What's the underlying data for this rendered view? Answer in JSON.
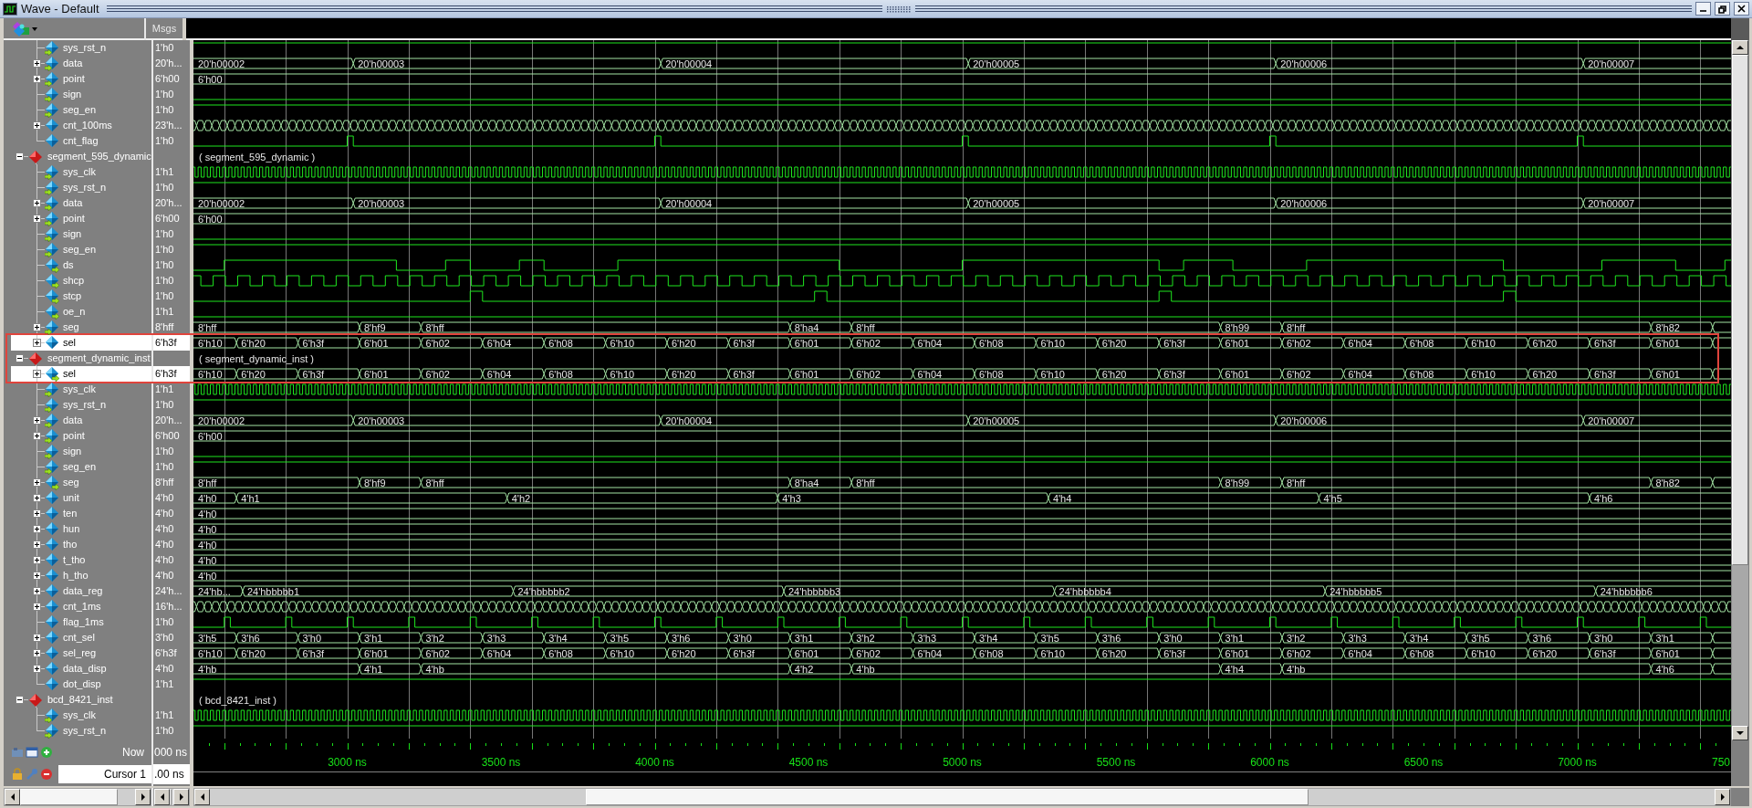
{
  "window": {
    "title": "Wave - Default"
  },
  "header": {
    "value_column": "Msgs"
  },
  "signals": [
    {
      "name": "sys_rst_n",
      "value": "1'h0",
      "kind": "bit",
      "input": true,
      "output": false,
      "expandable": false,
      "expanded": false,
      "selected": false,
      "highlighted": false
    },
    {
      "name": "data",
      "value": "20'h...",
      "kind": "bus",
      "input": true,
      "output": false,
      "expandable": true,
      "expanded": false,
      "selected": false,
      "highlighted": false,
      "values": [
        "20'h00002",
        "20'h00003",
        "20'h00004",
        "20'h00005",
        "20'h00006",
        "20'h00007"
      ]
    },
    {
      "name": "point",
      "value": "6'h00",
      "kind": "bus",
      "input": true,
      "output": false,
      "expandable": true,
      "expanded": false,
      "selected": false,
      "highlighted": false,
      "values": [
        "6'h00"
      ]
    },
    {
      "name": "sign",
      "value": "1'h0",
      "kind": "bit",
      "input": true,
      "output": false,
      "expandable": false,
      "expanded": false,
      "selected": false,
      "highlighted": false
    },
    {
      "name": "seg_en",
      "value": "1'h0",
      "kind": "bit",
      "input": true,
      "output": false,
      "expandable": false,
      "expanded": false,
      "selected": false,
      "highlighted": false
    },
    {
      "name": "cnt_100ms",
      "value": "23'h...",
      "kind": "bus",
      "input": false,
      "output": false,
      "expandable": true,
      "expanded": false,
      "selected": false,
      "highlighted": false
    },
    {
      "name": "cnt_flag",
      "value": "1'h0",
      "kind": "bit",
      "input": false,
      "output": false,
      "expandable": false,
      "expanded": false,
      "selected": false,
      "highlighted": false
    },
    {
      "name": "segment_595_dynamic",
      "kind": "group",
      "expandable": true,
      "expanded": true,
      "selected": false,
      "highlighted": false,
      "values": [
        "( segment_595_dynamic )"
      ]
    },
    {
      "name": "sys_clk",
      "value": "1'h1",
      "kind": "bit",
      "input": true,
      "output": false,
      "expandable": false,
      "expanded": false,
      "selected": false,
      "highlighted": false
    },
    {
      "name": "sys_rst_n",
      "value": "1'h0",
      "kind": "bit",
      "input": true,
      "output": false,
      "expandable": false,
      "expanded": false,
      "selected": false,
      "highlighted": false
    },
    {
      "name": "data",
      "value": "20'h...",
      "kind": "bus",
      "input": true,
      "output": false,
      "expandable": true,
      "expanded": false,
      "selected": false,
      "highlighted": false,
      "values": [
        "20'h00002",
        "20'h00003",
        "20'h00004",
        "20'h00005",
        "20'h00006",
        "20'h00007"
      ]
    },
    {
      "name": "point",
      "value": "6'h00",
      "kind": "bus",
      "input": true,
      "output": false,
      "expandable": true,
      "expanded": false,
      "selected": false,
      "highlighted": false,
      "values": [
        "6'h00"
      ]
    },
    {
      "name": "sign",
      "value": "1'h0",
      "kind": "bit",
      "input": true,
      "output": false,
      "expandable": false,
      "expanded": false,
      "selected": false,
      "highlighted": false
    },
    {
      "name": "seg_en",
      "value": "1'h0",
      "kind": "bit",
      "input": true,
      "output": false,
      "expandable": false,
      "expanded": false,
      "selected": false,
      "highlighted": false
    },
    {
      "name": "ds",
      "value": "1'h0",
      "kind": "bit",
      "input": false,
      "output": true,
      "expandable": false,
      "expanded": false,
      "selected": false,
      "highlighted": false
    },
    {
      "name": "shcp",
      "value": "1'h0",
      "kind": "bit",
      "input": false,
      "output": true,
      "expandable": false,
      "expanded": false,
      "selected": false,
      "highlighted": false
    },
    {
      "name": "stcp",
      "value": "1'h0",
      "kind": "bit",
      "input": false,
      "output": true,
      "expandable": false,
      "expanded": false,
      "selected": false,
      "highlighted": false
    },
    {
      "name": "oe_n",
      "value": "1'h1",
      "kind": "bit",
      "input": false,
      "output": true,
      "expandable": false,
      "expanded": false,
      "selected": false,
      "highlighted": false
    },
    {
      "name": "seg",
      "value": "8'hff",
      "kind": "bus",
      "input": true,
      "output": false,
      "expandable": true,
      "expanded": false,
      "selected": false,
      "highlighted": false,
      "values": [
        "8'hff",
        "8'hf9",
        "8'hff",
        "8'ha4",
        "8'hff",
        "8'h99",
        "8'hff",
        "8'h82"
      ]
    },
    {
      "name": "sel",
      "value": "6'h3f",
      "kind": "bus",
      "input": false,
      "output": false,
      "expandable": true,
      "expanded": false,
      "selected": true,
      "highlighted": true,
      "values": [
        "6'h10",
        "6'h20",
        "6'h3f",
        "6'h01",
        "6'h02",
        "6'h04",
        "6'h08",
        "6'h10",
        "6'h20",
        "6'h3f",
        "6'h01",
        "6'h02",
        "6'h04",
        "6'h08",
        "6'h10",
        "6'h20",
        "6'h3f",
        "6'h01",
        "6'h02",
        "6'h04",
        "6'h08",
        "6'h10",
        "6'h20",
        "6'h3f",
        "6'h01"
      ]
    },
    {
      "name": "segment_dynamic_inst",
      "kind": "group",
      "expandable": true,
      "expanded": true,
      "selected": false,
      "highlighted": true,
      "values": [
        "( segment_dynamic_inst )"
      ]
    },
    {
      "name": "sel",
      "value": "6'h3f",
      "kind": "bus",
      "input": false,
      "output": true,
      "expandable": true,
      "expanded": false,
      "selected": true,
      "highlighted": true,
      "values": [
        "6'h10",
        "6'h20",
        "6'h3f",
        "6'h01",
        "6'h02",
        "6'h04",
        "6'h08",
        "6'h10",
        "6'h20",
        "6'h3f",
        "6'h01",
        "6'h02",
        "6'h04",
        "6'h08",
        "6'h10",
        "6'h20",
        "6'h3f",
        "6'h01",
        "6'h02",
        "6'h04",
        "6'h08",
        "6'h10",
        "6'h20",
        "6'h3f",
        "6'h01"
      ]
    },
    {
      "name": "sys_clk",
      "value": "1'h1",
      "kind": "bit",
      "input": true,
      "output": false,
      "expandable": false,
      "expanded": false,
      "selected": false,
      "highlighted": false
    },
    {
      "name": "sys_rst_n",
      "value": "1'h0",
      "kind": "bit",
      "input": true,
      "output": false,
      "expandable": false,
      "expanded": false,
      "selected": false,
      "highlighted": false
    },
    {
      "name": "data",
      "value": "20'h...",
      "kind": "bus",
      "input": true,
      "output": false,
      "expandable": true,
      "expanded": false,
      "selected": false,
      "highlighted": false,
      "values": [
        "20'h00002",
        "20'h00003",
        "20'h00004",
        "20'h00005",
        "20'h00006",
        "20'h00007"
      ]
    },
    {
      "name": "point",
      "value": "6'h00",
      "kind": "bus",
      "input": true,
      "output": false,
      "expandable": true,
      "expanded": false,
      "selected": false,
      "highlighted": false,
      "values": [
        "6'h00"
      ]
    },
    {
      "name": "sign",
      "value": "1'h0",
      "kind": "bit",
      "input": true,
      "output": false,
      "expandable": false,
      "expanded": false,
      "selected": false,
      "highlighted": false
    },
    {
      "name": "seg_en",
      "value": "1'h0",
      "kind": "bit",
      "input": true,
      "output": false,
      "expandable": false,
      "expanded": false,
      "selected": false,
      "highlighted": false
    },
    {
      "name": "seg",
      "value": "8'hff",
      "kind": "bus",
      "input": false,
      "output": true,
      "expandable": true,
      "expanded": false,
      "selected": false,
      "highlighted": false,
      "values": [
        "8'hff",
        "8'hf9",
        "8'hff",
        "8'ha4",
        "8'hff",
        "8'h99",
        "8'hff",
        "8'h82"
      ]
    },
    {
      "name": "unit",
      "value": "4'h0",
      "kind": "bus",
      "input": false,
      "output": false,
      "expandable": true,
      "expanded": false,
      "selected": false,
      "highlighted": false,
      "values": [
        "4'h0",
        "4'h1",
        "4'h2",
        "4'h3",
        "4'h4",
        "4'h5",
        "4'h6"
      ]
    },
    {
      "name": "ten",
      "value": "4'h0",
      "kind": "bus",
      "input": false,
      "output": false,
      "expandable": true,
      "expanded": false,
      "selected": false,
      "highlighted": false,
      "values": [
        "4'h0"
      ]
    },
    {
      "name": "hun",
      "value": "4'h0",
      "kind": "bus",
      "input": false,
      "output": false,
      "expandable": true,
      "expanded": false,
      "selected": false,
      "highlighted": false,
      "values": [
        "4'h0"
      ]
    },
    {
      "name": "tho",
      "value": "4'h0",
      "kind": "bus",
      "input": false,
      "output": false,
      "expandable": true,
      "expanded": false,
      "selected": false,
      "highlighted": false,
      "values": [
        "4'h0"
      ]
    },
    {
      "name": "t_tho",
      "value": "4'h0",
      "kind": "bus",
      "input": false,
      "output": false,
      "expandable": true,
      "expanded": false,
      "selected": false,
      "highlighted": false,
      "values": [
        "4'h0"
      ]
    },
    {
      "name": "h_tho",
      "value": "4'h0",
      "kind": "bus",
      "input": false,
      "output": false,
      "expandable": true,
      "expanded": false,
      "selected": false,
      "highlighted": false,
      "values": [
        "4'h0"
      ]
    },
    {
      "name": "data_reg",
      "value": "24'h...",
      "kind": "bus",
      "input": false,
      "output": false,
      "expandable": true,
      "expanded": false,
      "selected": false,
      "highlighted": false,
      "values": [
        "24'hb...",
        "24'hbbbbb1",
        "24'hbbbbb2",
        "24'hbbbbb3",
        "24'hbbbbb4",
        "24'hbbbbb5",
        "24'hbbbbb6"
      ]
    },
    {
      "name": "cnt_1ms",
      "value": "16'h...",
      "kind": "bus",
      "input": false,
      "output": false,
      "expandable": true,
      "expanded": false,
      "selected": false,
      "highlighted": false
    },
    {
      "name": "flag_1ms",
      "value": "1'h0",
      "kind": "bit",
      "input": false,
      "output": false,
      "expandable": false,
      "expanded": false,
      "selected": false,
      "highlighted": false
    },
    {
      "name": "cnt_sel",
      "value": "3'h0",
      "kind": "bus",
      "input": false,
      "output": false,
      "expandable": true,
      "expanded": false,
      "selected": false,
      "highlighted": false,
      "values": [
        "3'h5",
        "3'h6",
        "3'h0",
        "3'h1",
        "3'h2",
        "3'h3",
        "3'h4",
        "3'h5",
        "3'h6",
        "3'h0",
        "3'h1",
        "3'h2",
        "3'h3",
        "3'h4",
        "3'h5",
        "3'h6",
        "3'h0",
        "3'h1",
        "3'h2",
        "3'h3",
        "3'h4",
        "3'h5",
        "3'h6",
        "3'h0",
        "3'h1"
      ]
    },
    {
      "name": "sel_reg",
      "value": "6'h3f",
      "kind": "bus",
      "input": false,
      "output": false,
      "expandable": true,
      "expanded": false,
      "selected": false,
      "highlighted": false,
      "values": [
        "6'h10",
        "6'h20",
        "6'h3f",
        "6'h01",
        "6'h02",
        "6'h04",
        "6'h08",
        "6'h10",
        "6'h20",
        "6'h3f",
        "6'h01",
        "6'h02",
        "6'h04",
        "6'h08",
        "6'h10",
        "6'h20",
        "6'h3f",
        "6'h01",
        "6'h02",
        "6'h04",
        "6'h08",
        "6'h10",
        "6'h20",
        "6'h3f",
        "6'h01"
      ]
    },
    {
      "name": "data_disp",
      "value": "4'h0",
      "kind": "bus",
      "input": false,
      "output": false,
      "expandable": true,
      "expanded": false,
      "selected": false,
      "highlighted": false,
      "values": [
        "4'hb",
        "4'h1",
        "4'hb",
        "4'h2",
        "4'hb",
        "4'h4",
        "4'hb",
        "4'h6"
      ]
    },
    {
      "name": "dot_disp",
      "value": "1'h1",
      "kind": "bit",
      "input": false,
      "output": false,
      "expandable": false,
      "expanded": false,
      "selected": false,
      "highlighted": false
    },
    {
      "name": "bcd_8421_inst",
      "kind": "group",
      "expandable": true,
      "expanded": true,
      "selected": false,
      "highlighted": false,
      "values": [
        "( bcd_8421_inst )"
      ]
    },
    {
      "name": "sys_clk",
      "value": "1'h1",
      "kind": "bit",
      "input": true,
      "output": false,
      "expandable": false,
      "expanded": false,
      "selected": false,
      "highlighted": false
    },
    {
      "name": "sys_rst_n",
      "value": "1'h0",
      "kind": "bit",
      "input": true,
      "output": false,
      "expandable": false,
      "expanded": false,
      "selected": false,
      "highlighted": false
    }
  ],
  "cursors": [
    {
      "label": "Now",
      "value": "000 ns",
      "kind": "now"
    },
    {
      "label": "Cursor 1",
      "value": ".00 ns",
      "kind": "cursor"
    }
  ],
  "timeline": {
    "labels": [
      "3000 ns",
      "3500 ns",
      "4000 ns",
      "4500 ns",
      "5000 ns",
      "5500 ns",
      "6000 ns",
      "6500 ns",
      "7000 ns",
      "750"
    ]
  }
}
